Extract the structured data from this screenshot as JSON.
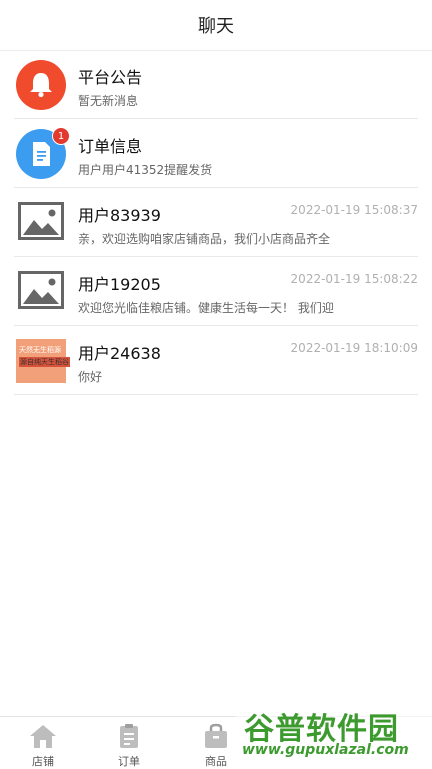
{
  "header": {
    "title": "聊天"
  },
  "conversations": [
    {
      "name": "平台公告",
      "preview": "暂无新消息",
      "time": ""
    },
    {
      "name": "订单信息",
      "preview": "用户用户41352提醒发货",
      "time": "",
      "badge": "1"
    },
    {
      "name": "用户83939",
      "preview": "亲，欢迎选购咱家店铺商品，我们小店商品齐全",
      "time": "2022-01-19 15:08:37"
    },
    {
      "name": "用户19205",
      "preview": "欢迎您光临佳粮店铺。健康生活每一天！ 我们迎",
      "time": "2022-01-19 15:08:22"
    },
    {
      "name": "用户24638",
      "preview": "你好",
      "time": "2022-01-19 18:10:09",
      "thumb_line1": "天然无生稻源",
      "thumb_line2": "源自纯天生稻谷"
    }
  ],
  "tabbar": {
    "items": [
      {
        "label": "店铺",
        "icon": "home-icon"
      },
      {
        "label": "订单",
        "icon": "clipboard-icon"
      },
      {
        "label": "商品",
        "icon": "bag-icon"
      }
    ]
  },
  "watermark": {
    "text": "谷普软件园",
    "url": "www.gupuxlazal.com"
  },
  "colors": {
    "bell": "#f04b2c",
    "doc": "#3b9cf0",
    "badge": "#e23a2f",
    "watermark": "#3c9a2e"
  }
}
